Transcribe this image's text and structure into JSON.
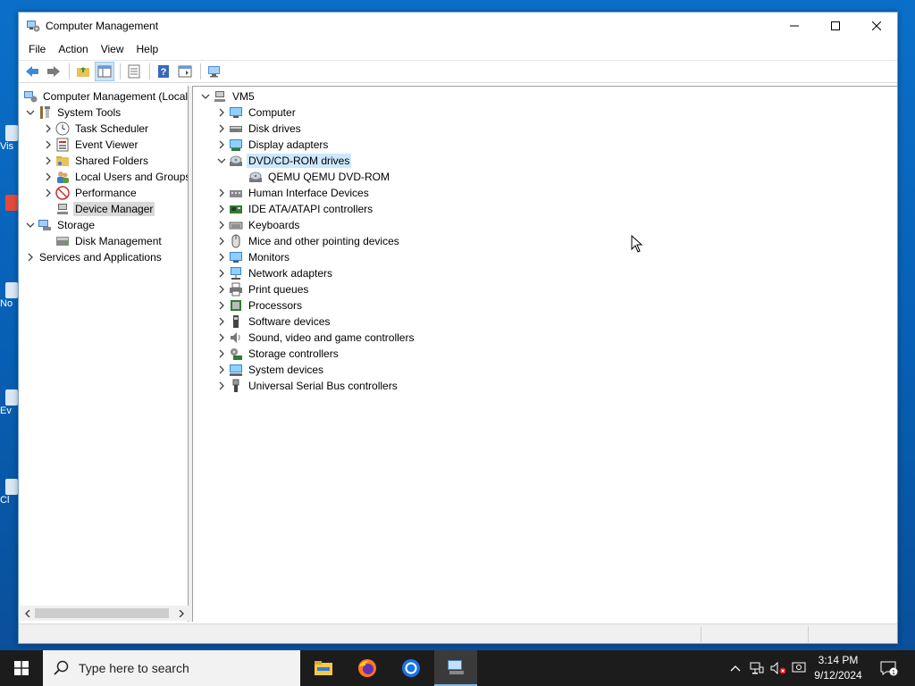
{
  "window": {
    "title": "Computer Management",
    "menu": [
      "File",
      "Action",
      "View",
      "Help"
    ]
  },
  "left_tree": {
    "root": "Computer Management (Local",
    "system_tools": "System Tools",
    "task_scheduler": "Task Scheduler",
    "event_viewer": "Event Viewer",
    "shared_folders": "Shared Folders",
    "local_users": "Local Users and Groups",
    "performance": "Performance",
    "device_manager": "Device Manager",
    "storage": "Storage",
    "disk_management": "Disk Management",
    "services": "Services and Applications"
  },
  "device_tree": {
    "root": "VM5",
    "categories": [
      "Computer",
      "Disk drives",
      "Display adapters",
      "DVD/CD-ROM drives",
      "Human Interface Devices",
      "IDE ATA/ATAPI controllers",
      "Keyboards",
      "Mice and other pointing devices",
      "Monitors",
      "Network adapters",
      "Print queues",
      "Processors",
      "Software devices",
      "Sound, video and game controllers",
      "Storage controllers",
      "System devices",
      "Universal Serial Bus controllers"
    ],
    "dvd_child": "QEMU QEMU DVD-ROM"
  },
  "taskbar": {
    "search_placeholder": "Type here to search",
    "time": "3:14 PM",
    "date": "9/12/2024",
    "notification_count": "1"
  },
  "desktop_labels": [
    "Vis",
    "No",
    "Ev",
    "Cl"
  ],
  "colors": {
    "selection_blue": "#cce8ff",
    "selection_grey": "#d9d9d9",
    "taskbar": "#1c1c1c",
    "desktop": "#0a63b6"
  }
}
